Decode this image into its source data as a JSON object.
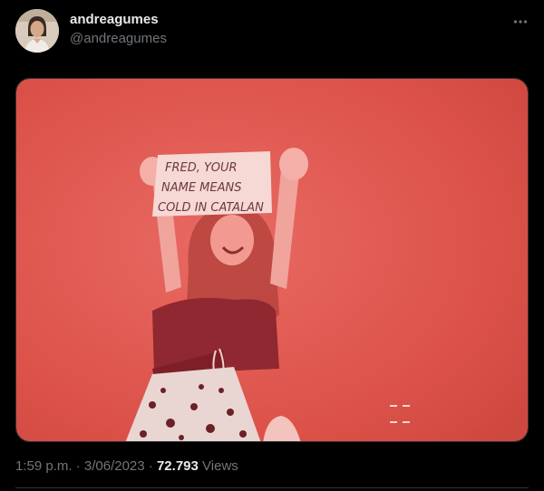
{
  "author": {
    "display_name": "andreagumes",
    "handle": "@andreagumes"
  },
  "media": {
    "sign_lines": [
      "FRED, YOUR",
      "NAME MEANS",
      "COLD IN CATALAN"
    ]
  },
  "meta": {
    "time": "1:59 p.m.",
    "separator": "·",
    "date": "3/06/2023",
    "views_count": "72.793",
    "views_label": "Views"
  },
  "colors": {
    "background": "#000000",
    "primary_text": "#e7e9ea",
    "secondary_text": "#71767b",
    "photo_tint": "#e0554f"
  },
  "icons": {
    "more": "more-horizontal-icon"
  }
}
